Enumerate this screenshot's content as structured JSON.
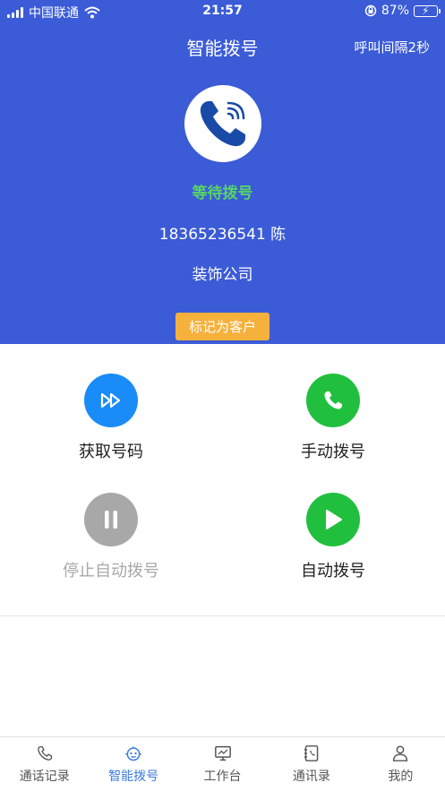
{
  "status_bar": {
    "carrier": "中国联通",
    "time": "21:57",
    "battery": "87%",
    "battery_level": 0.87
  },
  "header": {
    "title": "智能拨号",
    "interval": "呼叫间隔2秒"
  },
  "call_card": {
    "status": "等待拨号",
    "number_name": "18365236541 陈",
    "company": "装饰公司",
    "mark_button": "标记为客户"
  },
  "actions": {
    "get_number": {
      "label": "获取号码",
      "color": "#1a8cf8"
    },
    "manual_dial": {
      "label": "手动拨号",
      "color": "#21bf3e"
    },
    "stop_auto": {
      "label": "停止自动拨号",
      "color": "#a8a8a8"
    },
    "auto_dial": {
      "label": "自动拨号",
      "color": "#21bf3e"
    }
  },
  "tabs": [
    {
      "label": "通话记录",
      "icon": "phone-icon"
    },
    {
      "label": "智能拨号",
      "icon": "robot-icon",
      "active": true
    },
    {
      "label": "工作台",
      "icon": "monitor-icon"
    },
    {
      "label": "通讯录",
      "icon": "contacts-icon"
    },
    {
      "label": "我的",
      "icon": "person-icon"
    }
  ],
  "colors": {
    "header_bg": "#3b5bd7",
    "status_green": "#57d466",
    "mark_orange": "#f6b13c",
    "tab_active": "#3b7be0"
  }
}
